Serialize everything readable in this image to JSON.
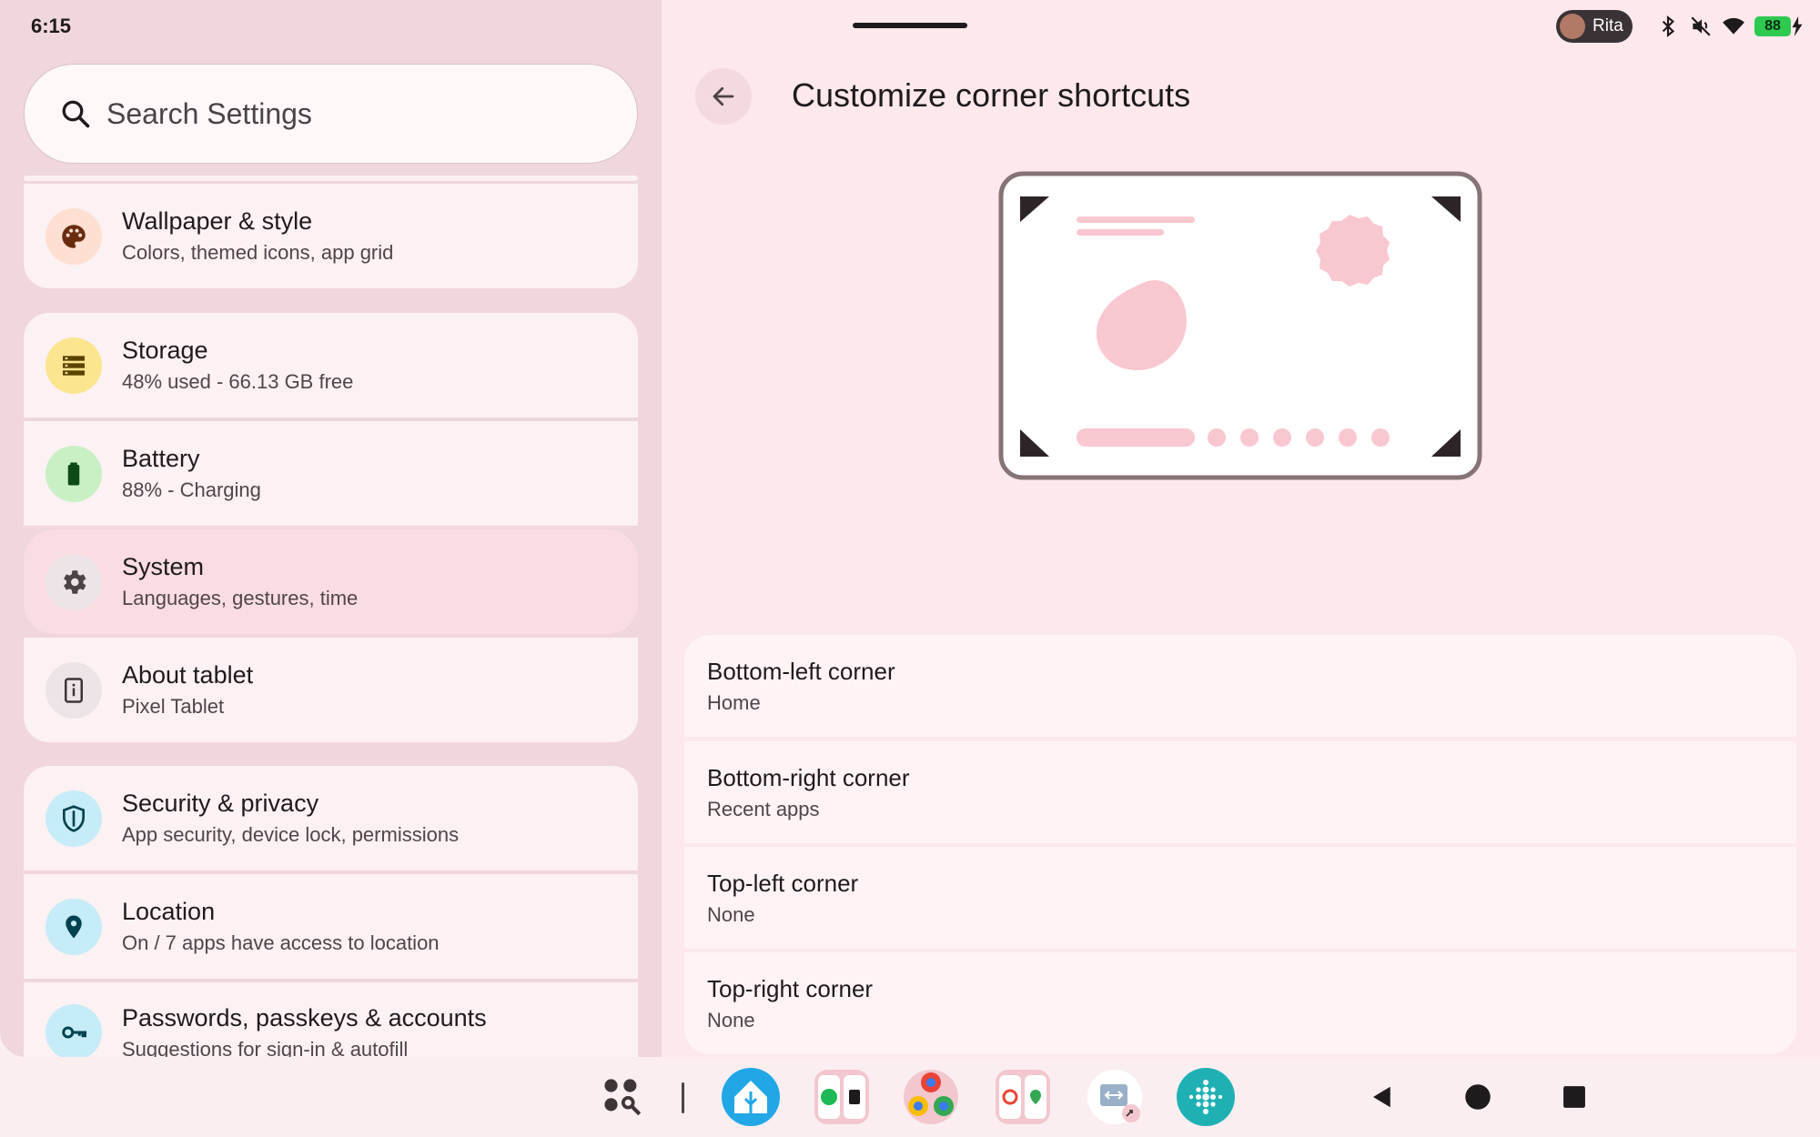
{
  "status": {
    "time": "6:15",
    "user": "Rita",
    "battery": "88"
  },
  "search": {
    "placeholder": "Search Settings"
  },
  "settings": [
    {
      "title": "Wallpaper & style",
      "sub": "Colors, themed icons, app grid",
      "icon": "palette-icon",
      "badge_color": "#fde0d2"
    },
    {
      "title": "Storage",
      "sub": "48% used - 66.13 GB free",
      "icon": "storage-icon",
      "badge_color": "#fbe58e"
    },
    {
      "title": "Battery",
      "sub": "88% - Charging",
      "icon": "battery-icon",
      "badge_color": "#c8f0c4"
    },
    {
      "title": "System",
      "sub": "Languages, gestures, time",
      "icon": "gear-icon",
      "badge_color": "#ece4e6"
    },
    {
      "title": "About tablet",
      "sub": "Pixel Tablet",
      "icon": "info-icon",
      "badge_color": "#ece4e6"
    },
    {
      "title": "Security & privacy",
      "sub": "App security, device lock, permissions",
      "icon": "shield-icon",
      "badge_color": "#c6ecf7"
    },
    {
      "title": "Location",
      "sub": "On / 7 apps have access to location",
      "icon": "location-icon",
      "badge_color": "#c6ecf7"
    },
    {
      "title": "Passwords, passkeys & accounts",
      "sub": "Suggestions for sign-in & autofill",
      "icon": "key-icon",
      "badge_color": "#c6ecf7"
    }
  ],
  "detail": {
    "title": "Customize corner shortcuts",
    "corners": [
      {
        "title": "Bottom-left corner",
        "value": "Home"
      },
      {
        "title": "Bottom-right corner",
        "value": "Recent apps"
      },
      {
        "title": "Top-left corner",
        "value": "None"
      },
      {
        "title": "Top-right corner",
        "value": "None"
      }
    ]
  },
  "taskbar": {
    "apps": [
      "all-apps-icon",
      "home-assistant-icon",
      "spotify-folder-icon",
      "chrome-folder-icon",
      "photos-maps-folder-icon",
      "remote-desktop-icon",
      "fitbit-icon"
    ],
    "nav": [
      "back-nav-icon",
      "home-nav-icon",
      "recents-nav-icon"
    ]
  },
  "colors": {
    "left_pane": "#efd7dc",
    "right_pane": "#fde8ec",
    "card": "#fcf1f3",
    "accent_pink": "#f9c7cf"
  }
}
